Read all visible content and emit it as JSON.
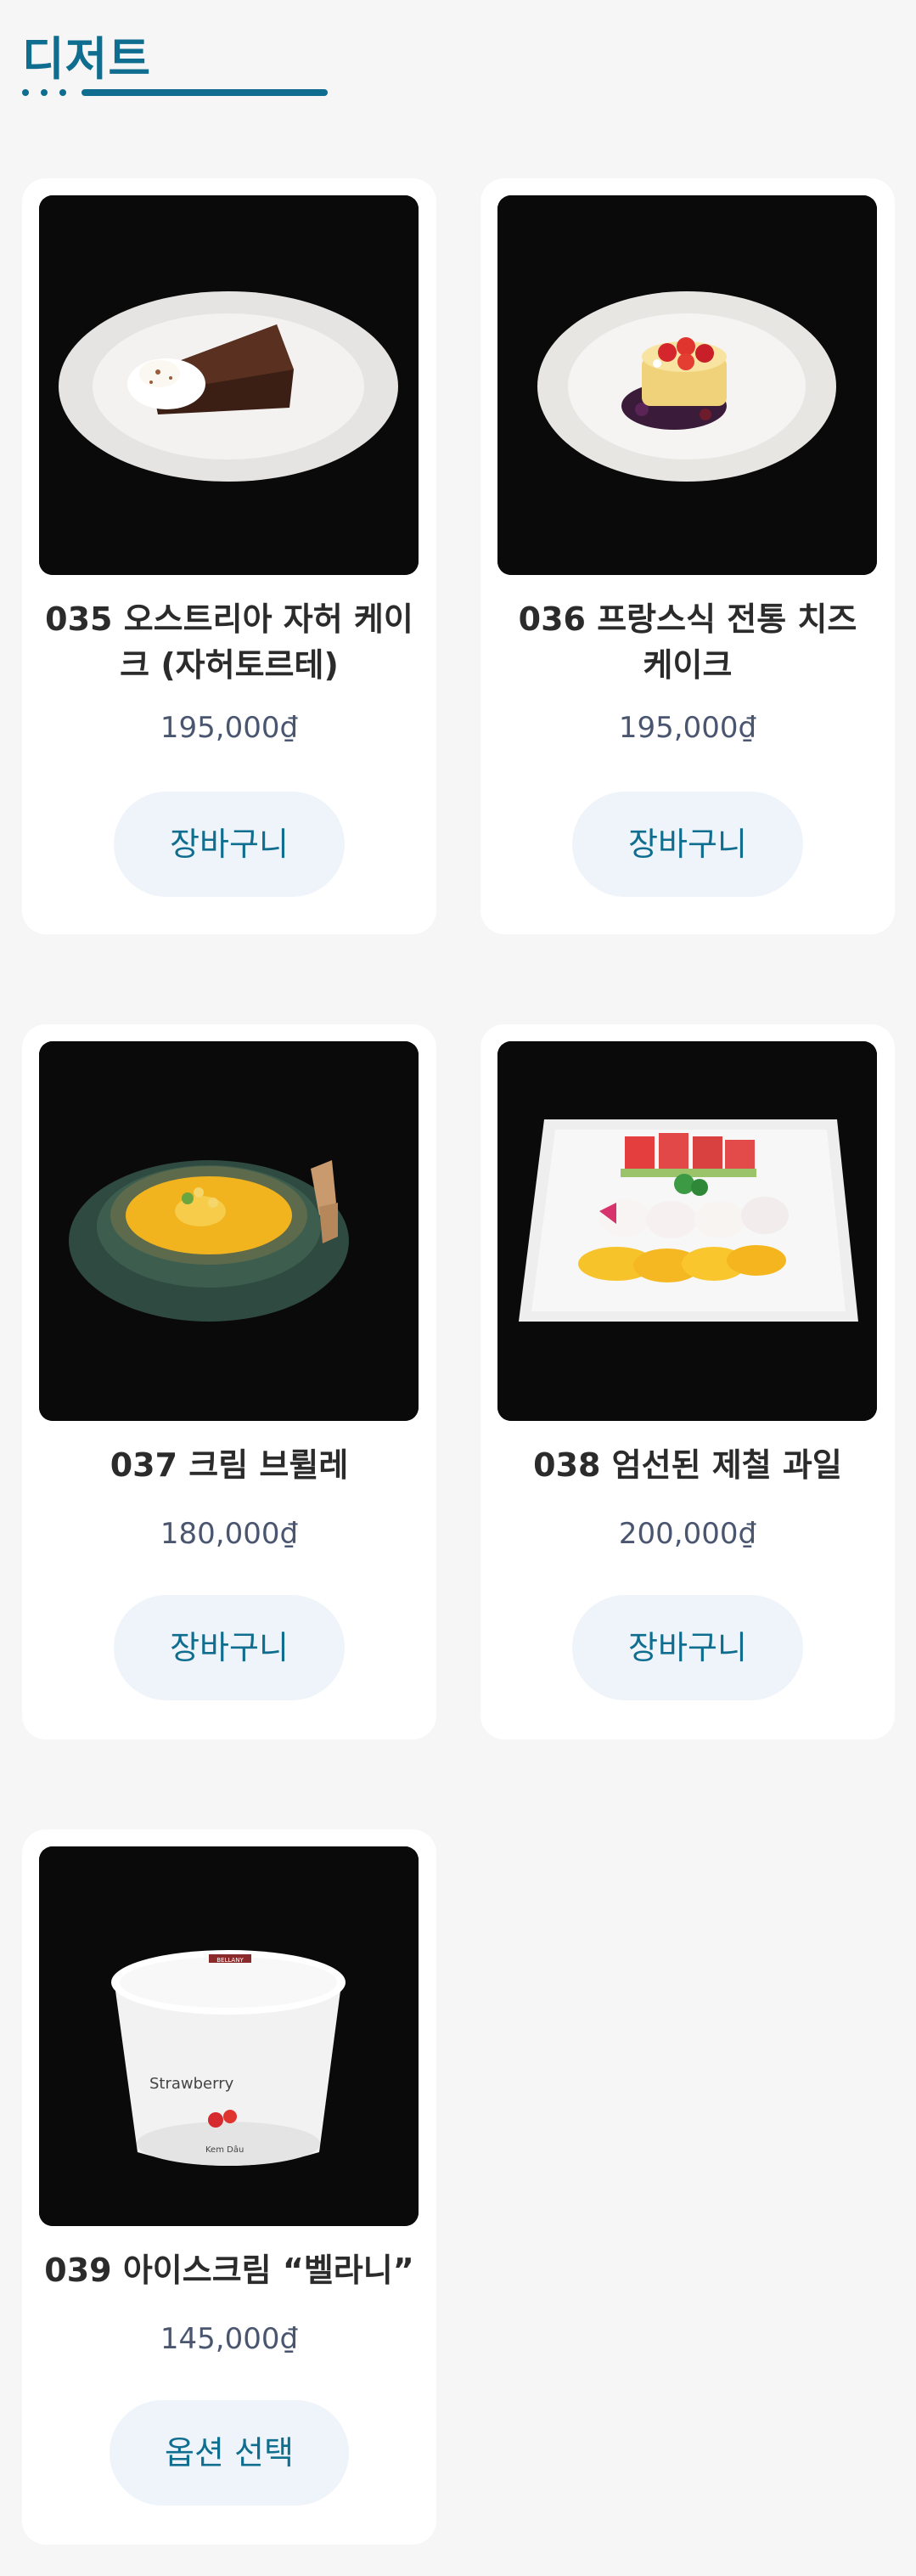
{
  "section": {
    "title": "디저트"
  },
  "products": [
    {
      "name": "035 오스트리아 자허 케이크 (자허토르테)",
      "price": "195,000₫",
      "button": "장바구니",
      "image_icon": "sacher-cake-image"
    },
    {
      "name": "036 프랑스식 전통 치즈 케이크",
      "price": "195,000₫",
      "button": "장바구니",
      "image_icon": "cheesecake-image"
    },
    {
      "name": "037 크림 브륄레",
      "price": "180,000₫",
      "button": "장바구니",
      "image_icon": "creme-brulee-image"
    },
    {
      "name": "038 엄선된 제철 과일",
      "price": "200,000₫",
      "button": "장바구니",
      "image_icon": "fruit-platter-image"
    },
    {
      "name": "039 아이스크림 “벨라니”",
      "price": "145,000₫",
      "button": "옵션 선택",
      "image_icon": "ice-cream-tub-image",
      "tub_brand": "BELLANY",
      "tub_flavor": "Strawberry",
      "tub_kind": "Kem Dâu"
    }
  ]
}
